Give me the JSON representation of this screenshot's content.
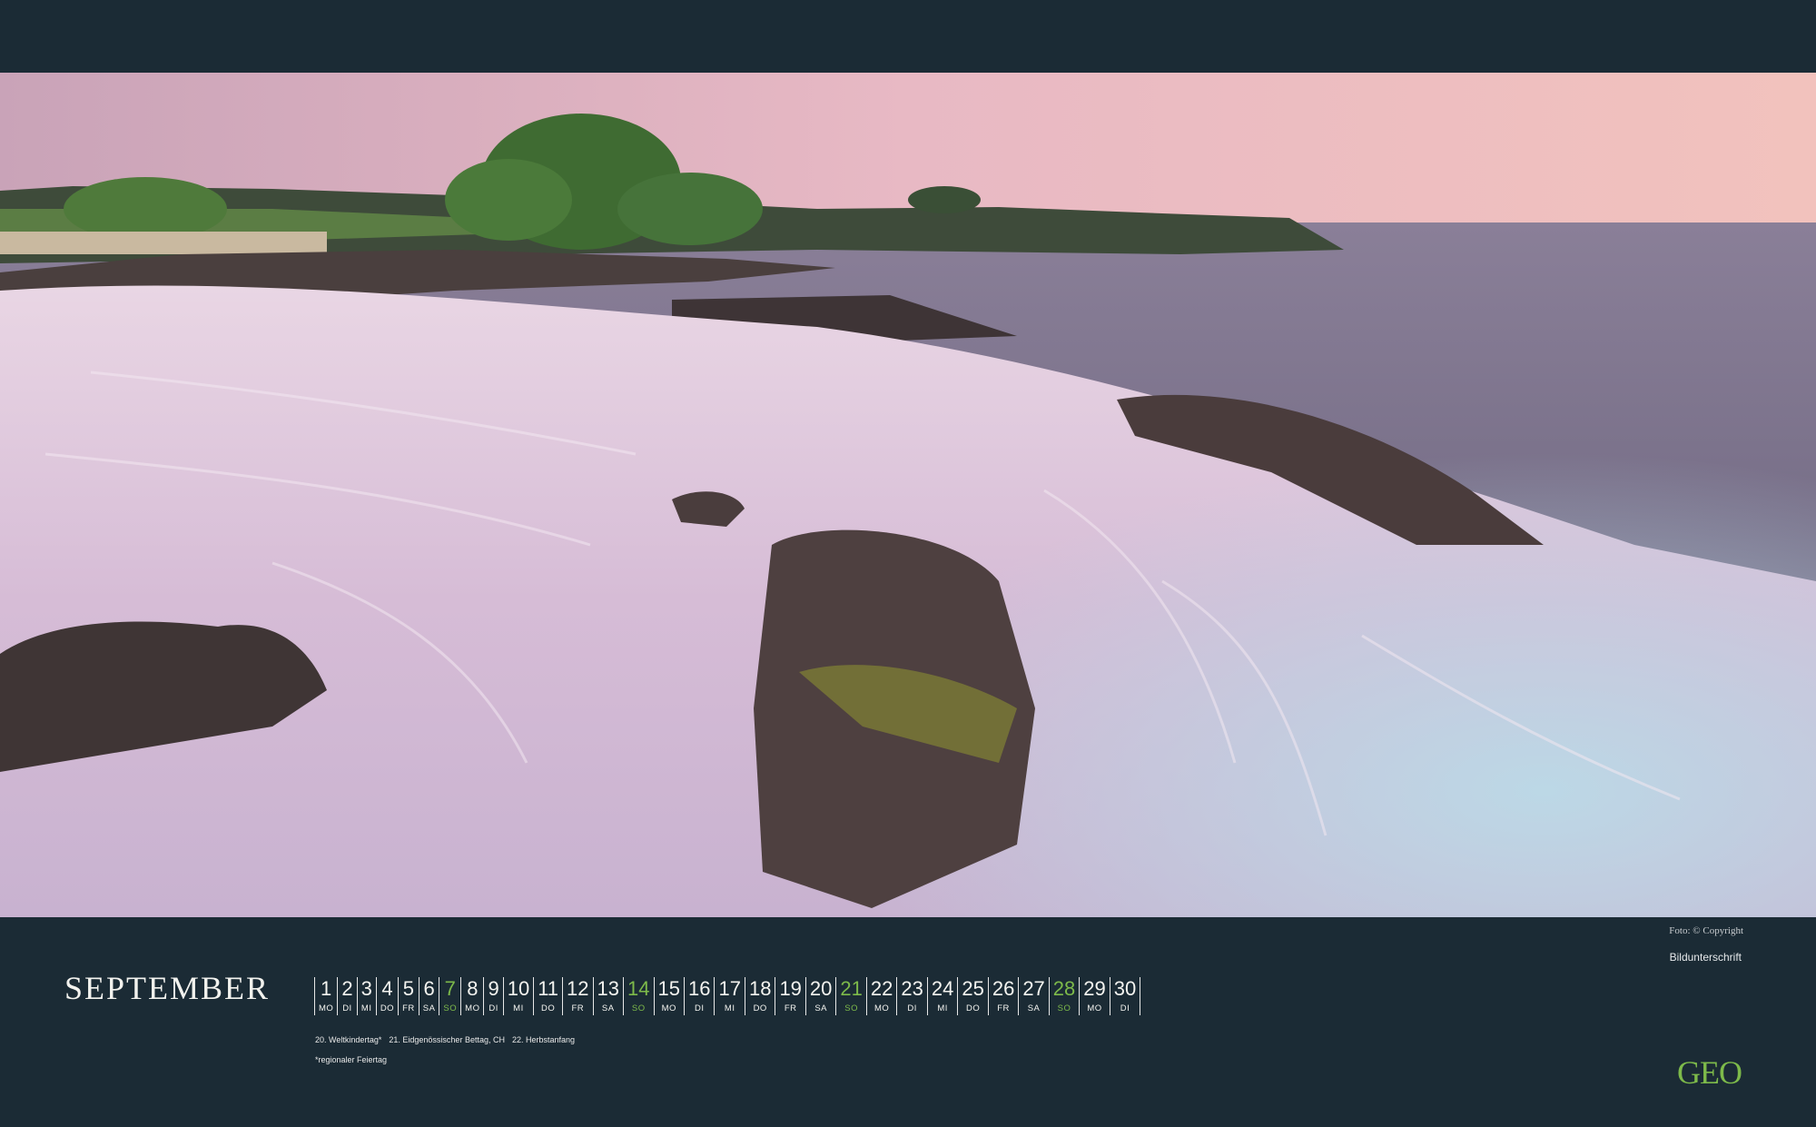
{
  "calendar": {
    "month": "SEPTEMBER",
    "days": [
      {
        "num": "1",
        "wd": "MO"
      },
      {
        "num": "2",
        "wd": "DI"
      },
      {
        "num": "3",
        "wd": "MI"
      },
      {
        "num": "4",
        "wd": "DO"
      },
      {
        "num": "5",
        "wd": "FR"
      },
      {
        "num": "6",
        "wd": "SA"
      },
      {
        "num": "7",
        "wd": "SO",
        "sunday": true
      },
      {
        "num": "8",
        "wd": "MO"
      },
      {
        "num": "9",
        "wd": "DI"
      },
      {
        "num": "10",
        "wd": "MI"
      },
      {
        "num": "11",
        "wd": "DO"
      },
      {
        "num": "12",
        "wd": "FR"
      },
      {
        "num": "13",
        "wd": "SA"
      },
      {
        "num": "14",
        "wd": "SO",
        "sunday": true
      },
      {
        "num": "15",
        "wd": "MO"
      },
      {
        "num": "16",
        "wd": "DI"
      },
      {
        "num": "17",
        "wd": "MI"
      },
      {
        "num": "18",
        "wd": "DO"
      },
      {
        "num": "19",
        "wd": "FR"
      },
      {
        "num": "20",
        "wd": "SA"
      },
      {
        "num": "21",
        "wd": "SO",
        "sunday": true
      },
      {
        "num": "22",
        "wd": "MO"
      },
      {
        "num": "23",
        "wd": "DI"
      },
      {
        "num": "24",
        "wd": "MI"
      },
      {
        "num": "25",
        "wd": "DO"
      },
      {
        "num": "26",
        "wd": "FR"
      },
      {
        "num": "27",
        "wd": "SA"
      },
      {
        "num": "28",
        "wd": "SO",
        "sunday": true
      },
      {
        "num": "29",
        "wd": "MO"
      },
      {
        "num": "30",
        "wd": "DI"
      }
    ],
    "holidays": [
      "20. Weltkindertag*",
      "21. Eidgenössischer Bettag, CH",
      "22. Herbstanfang"
    ],
    "footnote": "*regionaler Feiertag"
  },
  "photo": {
    "credit": "Foto: © Copyright",
    "caption": "Bildunterschrift"
  },
  "brand": {
    "logo": "GEO",
    "sunday_color": "#7dba4a",
    "background": "#1b2b35"
  }
}
